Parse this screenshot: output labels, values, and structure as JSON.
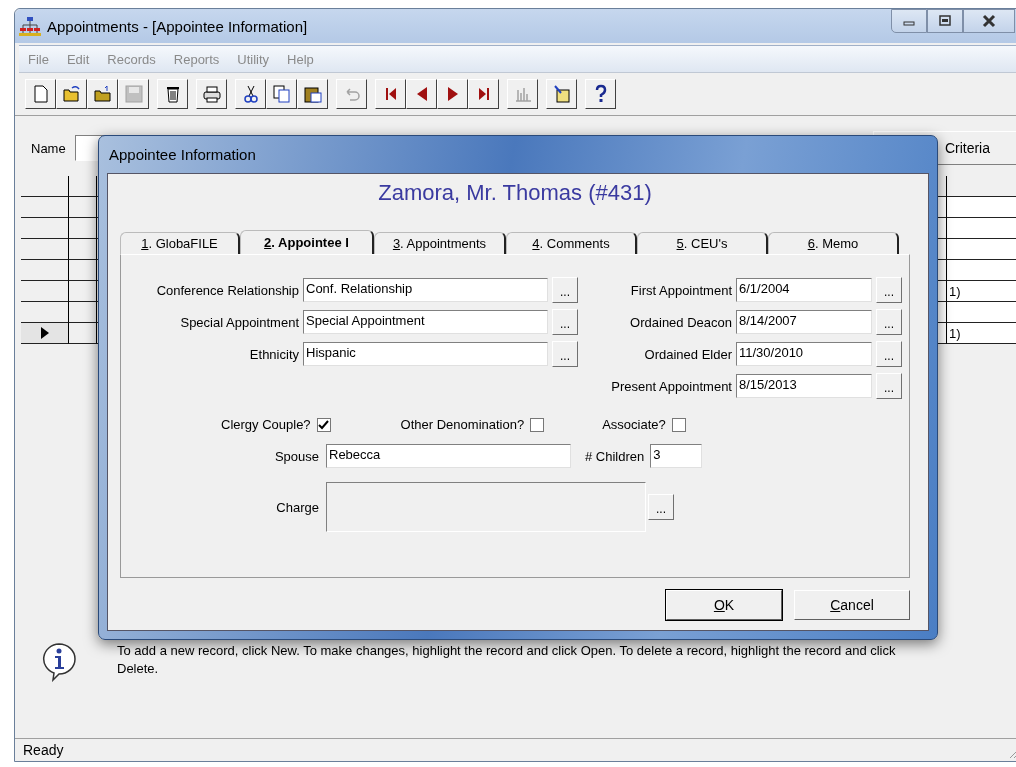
{
  "window": {
    "title": "Appointments - [Appointee Information]"
  },
  "menu": [
    {
      "label": "File",
      "disabled": true
    },
    {
      "label": "Edit",
      "disabled": true
    },
    {
      "label": "Records",
      "disabled": true
    },
    {
      "label": "Reports",
      "disabled": true
    },
    {
      "label": "Utility",
      "disabled": true
    },
    {
      "label": "Help",
      "disabled": true
    }
  ],
  "toolbar": [
    {
      "disabled": false
    },
    {
      "disabled": false
    },
    {
      "disabled": false
    },
    {
      "disabled": true
    },
    {
      "disabled": false
    },
    {
      "disabled": false
    },
    {
      "disabled": false
    },
    {
      "disabled": false
    },
    {
      "disabled": false
    },
    {
      "disabled": true
    },
    {
      "disabled": false
    },
    {
      "disabled": false
    },
    {
      "disabled": false
    },
    {
      "disabled": false
    },
    {
      "disabled": true
    },
    {
      "disabled": false
    },
    {
      "disabled": false
    }
  ],
  "filter": {
    "name_label": "Name",
    "criteria_button": "Criteria"
  },
  "grid": {
    "rows": [
      {
        "selected": false
      },
      {
        "selected": false
      },
      {
        "selected": false
      },
      {
        "selected": false
      },
      {
        "selected": false,
        "column_3": "1)"
      },
      {
        "selected": false
      },
      {
        "selected": true,
        "column_3": "1)"
      }
    ]
  },
  "info": {
    "text": "To add a new record, click New.  To make changes, highlight the record and click Open.  To delete a record, highlight the record and click Delete."
  },
  "status_bar": {
    "text": "Ready"
  },
  "dialog": {
    "title": "Appointee Information",
    "heading": "Zamora, Mr. Thomas (#431)",
    "tabs": [
      {
        "label": "1. GlobaFILE",
        "selected": false
      },
      {
        "label": "2. Appointee I",
        "selected": true
      },
      {
        "label": "3. Appointments",
        "selected": false
      },
      {
        "label": "4. Comments",
        "selected": false
      },
      {
        "label": "5. CEU's",
        "selected": false
      },
      {
        "label": "6. Memo",
        "selected": false
      }
    ],
    "left_fields": [
      {
        "label": "Conference Relationship",
        "value": "Conf. Relationship"
      },
      {
        "label": "Special Appointment",
        "value": "Special Appointment"
      },
      {
        "label": "Ethnicity",
        "value": "Hispanic"
      }
    ],
    "right_fields": [
      {
        "label": "First Appointment",
        "value": "6/1/2004"
      },
      {
        "label": "Ordained Deacon",
        "value": "8/14/2007"
      },
      {
        "label": "Ordained Elder",
        "value": "11/30/2010"
      },
      {
        "label": "Present Appointment",
        "value": "8/15/2013"
      }
    ],
    "checkboxes": [
      {
        "label": "Clergy Couple?",
        "checked": true
      },
      {
        "label": "Other Denomination?",
        "checked": false
      },
      {
        "label": "Associate?",
        "checked": false
      }
    ],
    "spouse": {
      "label": "Spouse",
      "value": "Rebecca"
    },
    "children": {
      "label": "# Children",
      "value": "3"
    },
    "charge": {
      "label": "Charge"
    },
    "browse_button": "...",
    "buttons": [
      {
        "label": "OK",
        "default": true
      },
      {
        "label": "Cancel",
        "default": false
      }
    ]
  }
}
